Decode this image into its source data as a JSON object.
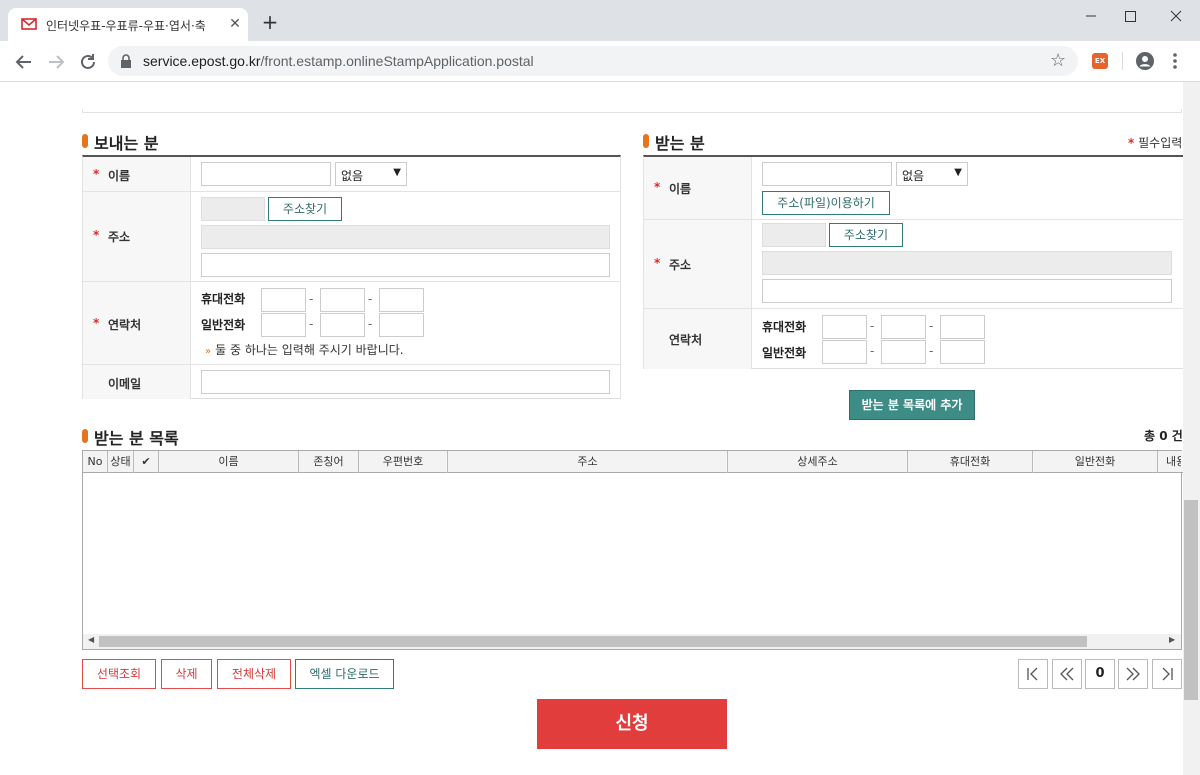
{
  "browser": {
    "tab_title": "인터넷우표-우표류-우표·엽서·축",
    "url_host": "service.epost.go.kr",
    "url_path": "/front.estamp.onlineStampApplication.postal",
    "tab_close": "✕",
    "new_tab": "+"
  },
  "sender": {
    "title": "보내는 분",
    "required_mark": "*",
    "name_label": "이름",
    "honorific_value": "없음",
    "address_label": "주소",
    "find_address": "주소찾기",
    "contact_label": "연락처",
    "mobile_label": "휴대전화",
    "phone_label": "일반전화",
    "contact_hint": "둘 중 하나는 입력해 주시기 바랍니다.",
    "email_label": "이메일",
    "dash": "-"
  },
  "receiver": {
    "title": "받는 분",
    "required_note": "필수입력",
    "required_mark": "*",
    "name_label": "이름",
    "honorific_value": "없음",
    "file_address_button": "주소(파일)이용하기",
    "address_label": "주소",
    "find_address": "주소찾기",
    "contact_label": "연락처",
    "mobile_label": "휴대전화",
    "phone_label": "일반전화",
    "add_button": "받는 분 목록에 추가",
    "dash": "-"
  },
  "list": {
    "title": "받는 분 목록",
    "total": "총 0 건",
    "columns": [
      "No",
      "상태",
      "✔",
      "이름",
      "존칭어",
      "우편번호",
      "주소",
      "상세주소",
      "휴대전화",
      "일반전화",
      "내용"
    ]
  },
  "actions": {
    "select_view": "선택조회",
    "delete": "삭제",
    "delete_all": "전체삭제",
    "excel_download": "엑셀 다운로드",
    "submit": "신청"
  },
  "pagination": {
    "first": "|◁",
    "prev": "≪",
    "current": "0",
    "next": "≫",
    "last": "▷|"
  },
  "colors": {
    "accent_orange": "#e8731f",
    "teal": "#3e8c86",
    "submit_red": "#e23d3d"
  }
}
